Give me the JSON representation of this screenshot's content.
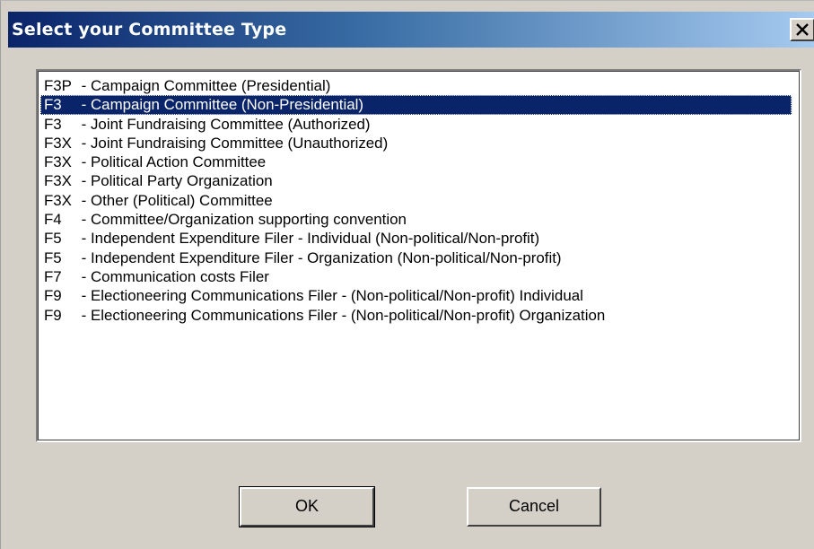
{
  "dialog": {
    "title": "Select your Committee Type",
    "close_label": "X"
  },
  "list": {
    "selected_index": 1,
    "items": [
      {
        "code": "F3P",
        "desc": "- Campaign Committee (Presidential)"
      },
      {
        "code": "F3",
        "desc": "- Campaign Committee (Non-Presidential)"
      },
      {
        "code": "F3",
        "desc": "- Joint Fundraising Committee (Authorized)"
      },
      {
        "code": "F3X",
        "desc": "- Joint Fundraising Committee (Unauthorized)"
      },
      {
        "code": "F3X",
        "desc": "- Political Action Committee"
      },
      {
        "code": "F3X",
        "desc": "- Political Party Organization"
      },
      {
        "code": "F3X",
        "desc": "- Other (Political) Committee"
      },
      {
        "code": "F4",
        "desc": "- Committee/Organization supporting convention"
      },
      {
        "code": "F5",
        "desc": "- Independent Expenditure Filer - Individual (Non-political/Non-profit)"
      },
      {
        "code": "F5",
        "desc": "- Independent Expenditure Filer - Organization (Non-political/Non-profit)"
      },
      {
        "code": "F7",
        "desc": "- Communication costs Filer"
      },
      {
        "code": "F9",
        "desc": "- Electioneering Communications Filer - (Non-political/Non-profit) Individual"
      },
      {
        "code": "F9",
        "desc": "- Electioneering Communications Filer - (Non-political/Non-profit) Organization"
      }
    ]
  },
  "buttons": {
    "ok_label": "OK",
    "cancel_label": "Cancel"
  },
  "colors": {
    "selection_bg": "#0a246a",
    "title_gradient_start": "#0a246a",
    "title_gradient_end": "#a6caf0",
    "face": "#d4d0c8"
  }
}
